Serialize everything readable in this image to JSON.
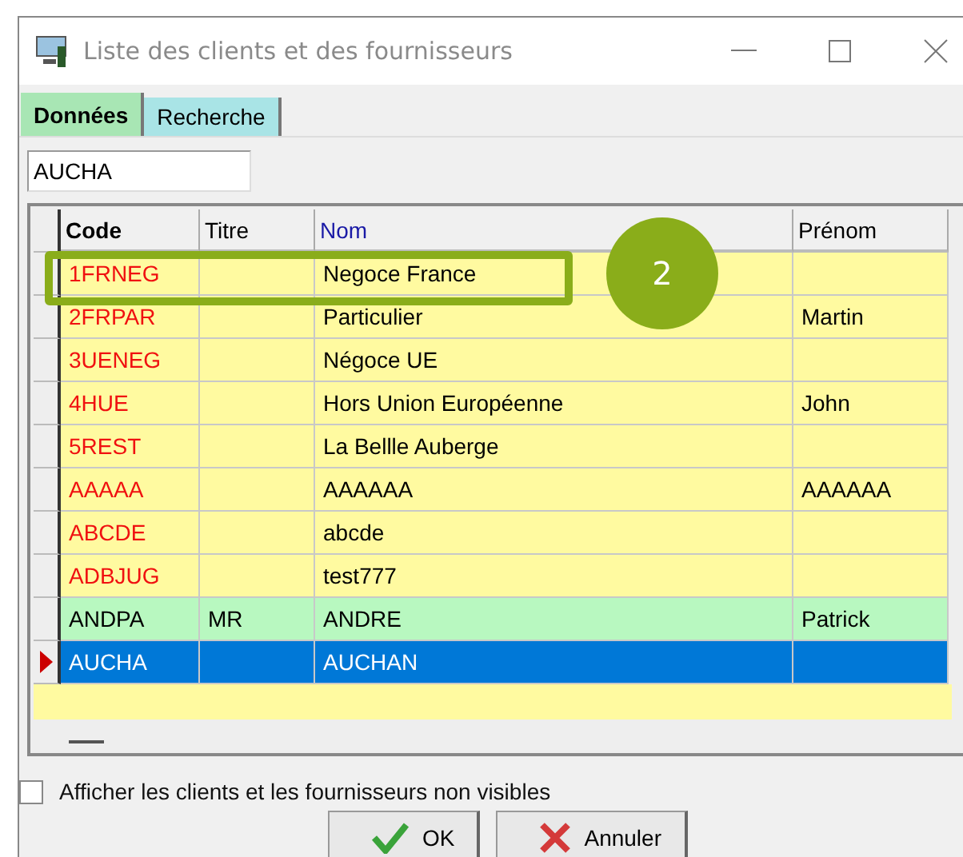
{
  "window": {
    "title": "Liste des clients et des fournisseurs"
  },
  "tabs": [
    {
      "label": "Données",
      "selected": true
    },
    {
      "label": "Recherche",
      "selected": false
    }
  ],
  "search": {
    "value": "AUCHA"
  },
  "table": {
    "columns": [
      "Code",
      "Titre",
      "Nom",
      "Prénom"
    ],
    "rows": [
      {
        "cells": [
          "1FRNEG",
          "",
          "Negoce France",
          ""
        ],
        "kind": "red",
        "selected": false
      },
      {
        "cells": [
          "2FRPAR",
          "",
          "Particulier",
          "Martin"
        ],
        "kind": "red",
        "selected": false
      },
      {
        "cells": [
          "3UENEG",
          "",
          "Négoce UE",
          ""
        ],
        "kind": "red",
        "selected": false
      },
      {
        "cells": [
          "4HUE",
          "",
          "Hors Union Européenne",
          "John"
        ],
        "kind": "red",
        "selected": false
      },
      {
        "cells": [
          "5REST",
          "",
          "La Bellle Auberge",
          ""
        ],
        "kind": "red",
        "selected": false
      },
      {
        "cells": [
          "AAAAA",
          "",
          "AAAAAA",
          "AAAAAA"
        ],
        "kind": "red",
        "selected": false
      },
      {
        "cells": [
          "ABCDE",
          "",
          "abcde",
          ""
        ],
        "kind": "red",
        "selected": false
      },
      {
        "cells": [
          "ADBJUG",
          "",
          "test777",
          ""
        ],
        "kind": "red",
        "selected": false
      },
      {
        "cells": [
          "ANDPA",
          "MR",
          "ANDRE",
          "Patrick"
        ],
        "kind": "green",
        "selected": false
      },
      {
        "cells": [
          "AUCHA",
          "",
          "AUCHAN",
          ""
        ],
        "kind": "plain",
        "selected": true
      }
    ]
  },
  "show_hidden": {
    "label": "Afficher les clients et les fournisseurs non visibles",
    "checked": false
  },
  "buttons": [
    {
      "label": "OK",
      "kind": "ok"
    },
    {
      "label": "Annuler",
      "kind": "cancel"
    }
  ],
  "annotation": {
    "label": "2"
  }
}
